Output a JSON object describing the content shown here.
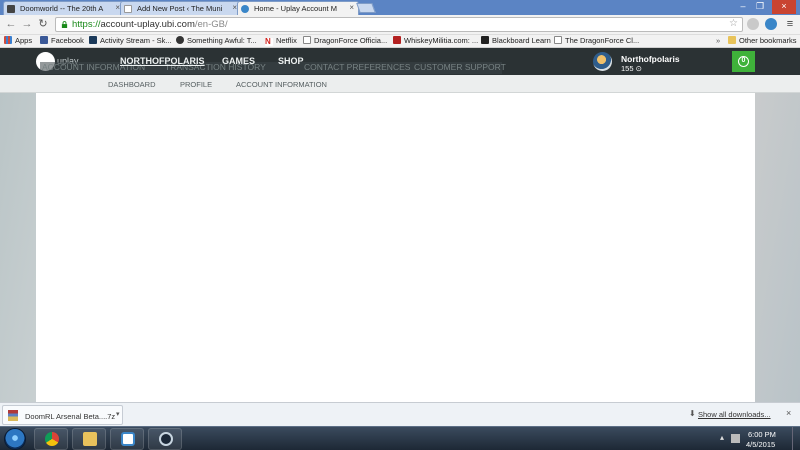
{
  "browser": {
    "tabs": [
      {
        "label": "Doomworld -- The 20th A",
        "active": false
      },
      {
        "label": "Add New Post ‹ The Muni",
        "active": false
      },
      {
        "label": "Home - Uplay Account M",
        "active": true
      }
    ],
    "url_scheme": "https://",
    "url_host": "account-uplay.ubi.com",
    "url_path": "/en-GB/",
    "bookmarks": [
      "Apps",
      "Facebook",
      "Activity Stream - Sk...",
      "Something Awful: T...",
      "Netflix",
      "DragonForce Officia...",
      "WhiskeyMilitia.com: ...",
      "Blackboard Learn",
      "The DragonForce Cl..."
    ],
    "other_bookmarks": "Other bookmarks"
  },
  "site": {
    "logo_text": "uplay",
    "ghost_nav": [
      "ACCOUNT INFORMATION",
      "TRANSACTION HISTORY",
      "CONTACT PREFERENCES",
      "CUSTOMER SUPPORT"
    ],
    "nav": [
      "NORTHOFPOLARIS",
      "GAMES",
      "SHOP"
    ],
    "user_name": "Northofpolaris",
    "user_points": "155",
    "notification_count": "0",
    "subnav": [
      "DASHBOARD",
      "PROFILE",
      "ACCOUNT INFORMATION"
    ],
    "accent_color": "#3fb23a"
  },
  "downloads": {
    "item": "DoomRL Arsenal Beta....7z",
    "show_all": "Show all downloads..."
  },
  "taskbar": {
    "time": "6:00 PM",
    "date": "4/5/2015"
  }
}
